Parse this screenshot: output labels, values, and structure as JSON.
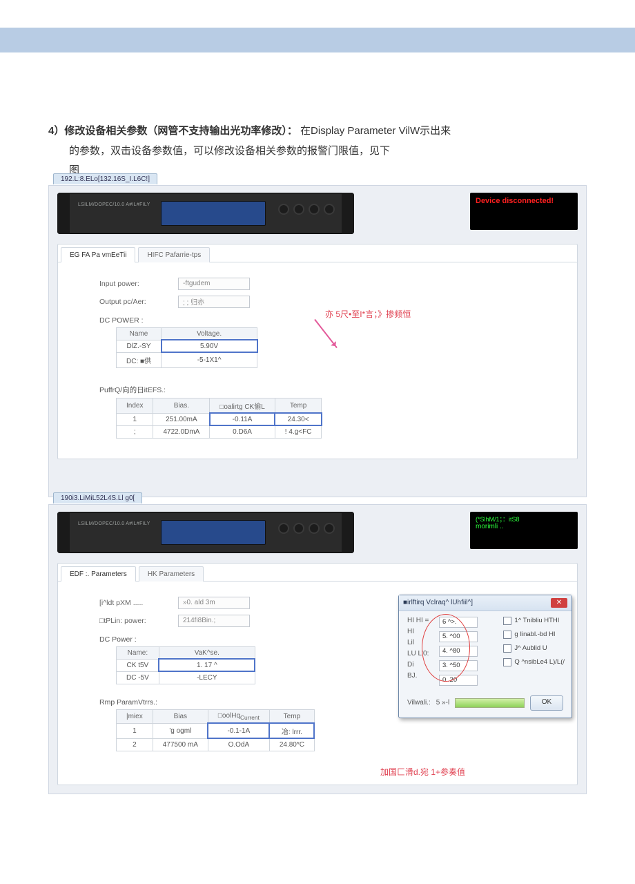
{
  "heading": {
    "prefix": "4）修改设备相关参数（网管不支持输出光功率修改）：",
    "rest1": "在Display Parameter VilW示出来",
    "line2": "的参数，双击设备参数值，可以修改设备相关参数的报警门限值，见下",
    "line3": "图"
  },
  "shot1": {
    "tab_title": "192.L:8.ELo[132.16S_I.L6C!]",
    "status": "Device disconnected!",
    "device_label": "LSILM/DOPEC/10.0 A#IL#FILY",
    "tabs": {
      "a": "EG FA Pa vmEeTii",
      "b": "HIFC Pafarrie-tps"
    },
    "form": {
      "input_label": "Input power:",
      "input_val": "-ftgudem",
      "output_label": "Output pc/Aer:",
      "output_val": "; ;    归亦",
      "dc_label": "DC POWER :"
    },
    "dc_table": {
      "h1": "Name",
      "h2": "Voltage.",
      "r1c1": "DlZ.-SY",
      "r1c2": "5.90V",
      "r2c1": "DC: ■供",
      "r2c2": "-5-1X1^"
    },
    "pump_label": "PuffrQ/向的日itEFS.:",
    "pump_table": {
      "h1": "Index",
      "h2": "Bias.",
      "h3": "□oalirtg CK偷L",
      "h4": "Temp",
      "r1": {
        "c1": "1",
        "c2": "251.00mA",
        "c3": "-0.11A",
        "c4": "24.30<"
      },
      "r2": {
        "c1": ";",
        "c2": "4722.0DmA",
        "c3": "0.D6A",
        "c4": "! 4.g<FC"
      }
    },
    "anno1": "亦   5尺•至I*言；》掺频恒"
  },
  "shot2": {
    "tab_title": "190i3.LiMiL52L4S.Ll g0[",
    "status_small": "(*SlhM/1；：itS8",
    "status": "morimli  ..",
    "device_label": "LSILM/DOPEC/10.0 A#IL#FILY",
    "tabs": {
      "a": "EDF :. Parameters",
      "b": "HK   Parameters"
    },
    "form": {
      "input_label": "[i^ldt pXM .....",
      "input_val": "»0. ald 3m",
      "output_label": "□tPLin: power:",
      "output_val": "214fi8Bin.;",
      "dc_label": "DC Power :"
    },
    "dc_table": {
      "h1": "Name:",
      "h2": "VaK^se.",
      "r1c1": "CK t5V",
      "r1c2": "1. 17 ^",
      "r2c1": "DC -5V",
      "r2c2": "-LECY"
    },
    "pump_label": "Rmp ParamVtrrs.:",
    "pump_table": {
      "h1": "|miex",
      "h2": "Bias",
      "h3_a": "□oolHq",
      "h3_b": "Current",
      "h4": "Temp",
      "r1": {
        "c1": "1",
        "c2": "'g ogml",
        "c3": "-0.1-1A",
        "c4": "冶: lrrr."
      },
      "r2": {
        "c1": "2",
        "c2": "477500 mA",
        "c3": "O.OdA",
        "c4": "24.80*C"
      }
    },
    "anno1": "加国匚滑d.宛 1+参奏值",
    "dialog": {
      "title": "■irlftirq Vclraq^ lUhfiil^]",
      "rows": {
        "hihi_l": "HI HI =",
        "hihi_v": "6 ^>.",
        "hi_l": "HI",
        "hi_v": "5. ^00",
        "lil_l": "Lil",
        "lil_v": "4. ^80",
        "lulo_l": "LU L'0:",
        "lulo_v": "3. ^50",
        "di_l": "Di",
        "di_v": "0 .20",
        "bj_l": "BJ."
      },
      "checks": {
        "c1": "1^ Tnibliu HTHI",
        "c2": "g Iinabl.-bd HI",
        "c3": "J^ Aublid U",
        "c4": "Q  ^nsibLe4 L)/L(/"
      },
      "vil_l": "Vilwali.:",
      "vil_v": "5 »-l",
      "ok": "OK"
    }
  }
}
